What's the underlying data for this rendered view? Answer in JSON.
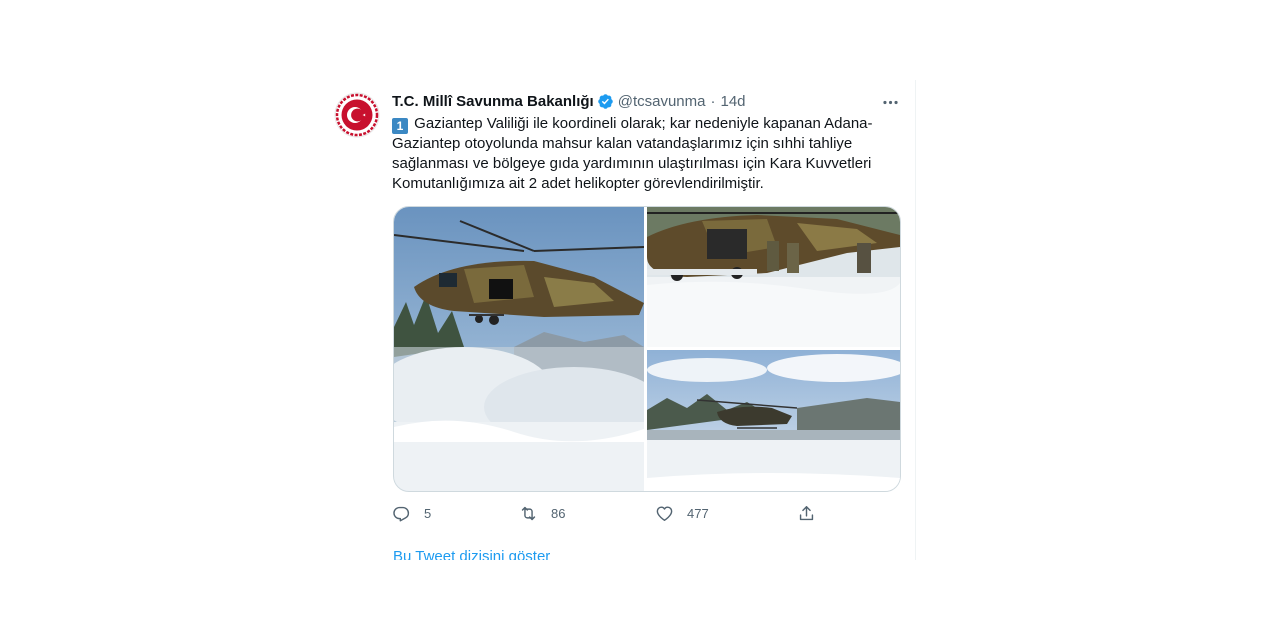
{
  "tweet": {
    "account_name": "T.C. Millî Savunma Bakanlığı",
    "handle": "@tcsavunma",
    "separator": "·",
    "time": "14d",
    "keycap": "1",
    "body": "Gaziantep Valiliği ile koordineli olarak; kar nedeniyle kapanan Adana-Gaziantep otoyolunda mahsur kalan vatandaşlarımız için sıhhi tahliye sağlanması ve bölgeye gıda yardımının ulaştırılması için Kara Kuvvetleri Komutanlığımıza ait 2 adet helikopter görevlendirilmiştir.",
    "media_count": 3
  },
  "actions": {
    "reply_count": "5",
    "retweet_count": "86",
    "like_count": "477"
  },
  "thread_link": "Bu Tweet dizisini göster",
  "colors": {
    "link": "#1d9bf0",
    "verified": "#1d9bf0",
    "secondary_text": "#536471",
    "avatar_red": "#c8102e"
  },
  "icons": [
    "verified-badge-icon",
    "more-icon",
    "reply-icon",
    "retweet-icon",
    "like-icon",
    "share-icon"
  ]
}
